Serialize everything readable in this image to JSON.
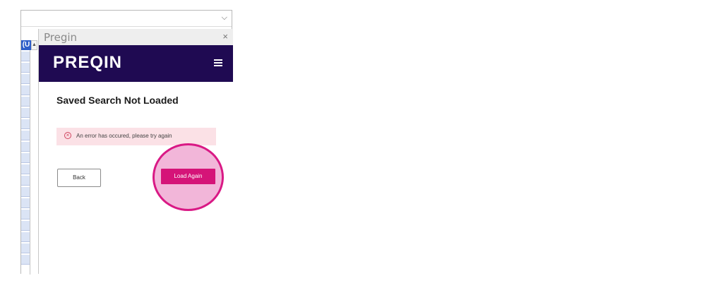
{
  "top_dropdown": {
    "chevron": "⌵"
  },
  "sheet": {
    "cell_tag": "(U"
  },
  "pane": {
    "title": "Pregin",
    "close_glyph": "×"
  },
  "brand": {
    "logo": "PREQIN",
    "menu_icon": "hamburger-icon"
  },
  "content": {
    "title": "Saved Search Not Loaded",
    "error_icon": "error-circle-icon",
    "error_message": "An error has occured, please try again",
    "back_label": "Back",
    "load_again_label": "Load Again"
  },
  "colors": {
    "brand_header": "#1f0a52",
    "accent": "#d51478",
    "error_bg": "#fbe1e6",
    "highlight": "#f2b6d9"
  }
}
